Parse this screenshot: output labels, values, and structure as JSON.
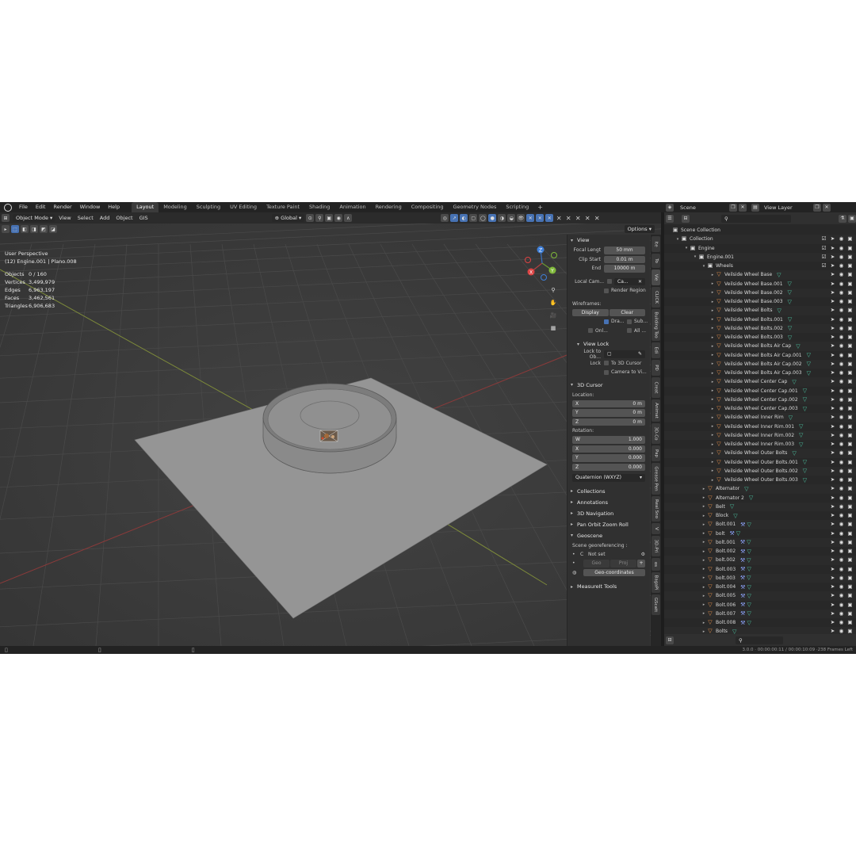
{
  "topbar": {
    "menus": [
      "File",
      "Edit",
      "Render",
      "Window",
      "Help"
    ],
    "workspaces": [
      "Layout",
      "Modeling",
      "Sculpting",
      "UV Editing",
      "Texture Paint",
      "Shading",
      "Animation",
      "Rendering",
      "Compositing",
      "Geometry Nodes",
      "Scripting"
    ],
    "active_workspace": "Layout",
    "add_tab": "+",
    "scene_label": "Scene",
    "view_layer_label": "View Layer"
  },
  "viewport_header": {
    "mode": "Object Mode",
    "menus": [
      "View",
      "Select",
      "Add",
      "Object",
      "GIS"
    ],
    "transform_orientation": "Global",
    "options_label": "Options"
  },
  "viewport": {
    "perspective": "User Perspective",
    "context": "(12) Engine.001 | Plano.008",
    "stats": [
      {
        "label": "Objects",
        "value": "0 / 160"
      },
      {
        "label": "Vertices",
        "value": "3,499,979"
      },
      {
        "label": "Edges",
        "value": "6,963,197"
      },
      {
        "label": "Faces",
        "value": "3,462,561"
      },
      {
        "label": "Triangles",
        "value": "6,906,683"
      }
    ],
    "gizmo_axes": [
      "X",
      "Y",
      "Z"
    ]
  },
  "npanel": {
    "view": {
      "title": "View",
      "focal_length_label": "Focal Lengt",
      "focal_length": "50 mm",
      "clip_start_label": "Clip Start",
      "clip_start": "0.01 m",
      "clip_end_label": "End",
      "clip_end": "10000 m",
      "local_camera_label": "Local Cam...",
      "local_camera_value": "Ca...",
      "render_region_label": "Render Region",
      "wireframes_label": "Wireframes:",
      "display_btn": "Display",
      "clear_btn": "Clear",
      "draw_label": "Dra...",
      "sub_label": "Sub...",
      "onl_label": "Onl...",
      "all_label": "All ..."
    },
    "view_lock": {
      "title": "View Lock",
      "lock_to_object_label": "Lock to Ob...",
      "lock_label": "Lock",
      "to_3d_cursor": "To 3D Cursor",
      "camera_to_view": "Camera to Vi..."
    },
    "cursor": {
      "title": "3D Cursor",
      "location_label": "Location:",
      "location": [
        {
          "axis": "X",
          "value": "0 m"
        },
        {
          "axis": "Y",
          "value": "0 m"
        },
        {
          "axis": "Z",
          "value": "0 m"
        }
      ],
      "rotation_label": "Rotation:",
      "rotation": [
        {
          "axis": "W",
          "value": "1.000"
        },
        {
          "axis": "X",
          "value": "0.000"
        },
        {
          "axis": "Y",
          "value": "0.000"
        },
        {
          "axis": "Z",
          "value": "0.000"
        }
      ],
      "rotation_mode": "Quaternion (WXYZ)"
    },
    "collapsed_sections": [
      "Collections",
      "Annotations",
      "3D Navigation",
      "Pan Orbit Zoom Roll"
    ],
    "geoscene": {
      "title": "Geoscene",
      "georef_label": "Scene georeferencing :",
      "crs_label": "C",
      "crs_value": "Not set",
      "geo_btn": "Geo",
      "proj_btn": "Proj",
      "plus_btn": "+",
      "geo_coords_btn": "Geo-coordinates"
    },
    "measureit": "MeasureIt Tools"
  },
  "vertical_tabs": [
    "Ite",
    "To",
    "Vie",
    "CLICK",
    "Building Too",
    "Edi",
    "PD",
    "Creat",
    "Animat",
    "3D-Co",
    "Pap",
    "Grease Pen",
    "Real Sno",
    "V",
    "3D-Pri",
    "os",
    "BagaPi",
    "GScatt"
  ],
  "outliner": {
    "scene_collection": "Scene Collection",
    "rows": [
      {
        "level": 1,
        "type": "coll",
        "name": "Collection",
        "arrow": "▾",
        "check": true
      },
      {
        "level": 2,
        "type": "coll",
        "name": "Engine",
        "arrow": "▾",
        "check": true
      },
      {
        "level": 3,
        "type": "coll",
        "name": "Engine.001",
        "arrow": "▾",
        "check": true
      },
      {
        "level": 4,
        "type": "coll",
        "name": "Wheels",
        "arrow": "▾",
        "check": true
      },
      {
        "level": 5,
        "type": "obj",
        "name": "Veilside Wheel Base",
        "mod": true
      },
      {
        "level": 5,
        "type": "obj",
        "name": "Veilside Wheel Base.001",
        "mod": true
      },
      {
        "level": 5,
        "type": "obj",
        "name": "Veilside Wheel Base.002",
        "mod": true
      },
      {
        "level": 5,
        "type": "obj",
        "name": "Veilside Wheel Base.003",
        "mod": true
      },
      {
        "level": 5,
        "type": "obj",
        "name": "Veilside Wheel Bolts",
        "mod": true
      },
      {
        "level": 5,
        "type": "obj",
        "name": "Veilside Wheel Bolts.001",
        "mod": true
      },
      {
        "level": 5,
        "type": "obj",
        "name": "Veilside Wheel Bolts.002",
        "mod": true
      },
      {
        "level": 5,
        "type": "obj",
        "name": "Veilside Wheel Bolts.003",
        "mod": true
      },
      {
        "level": 5,
        "type": "obj",
        "name": "Veilside Wheel Bolts Air Cap",
        "mod": true
      },
      {
        "level": 5,
        "type": "obj",
        "name": "Veilside Wheel Bolts Air Cap.001",
        "mod": true
      },
      {
        "level": 5,
        "type": "obj",
        "name": "Veilside Wheel Bolts Air Cap.002",
        "mod": true
      },
      {
        "level": 5,
        "type": "obj",
        "name": "Veilside Wheel Bolts Air Cap.003",
        "mod": true
      },
      {
        "level": 5,
        "type": "obj",
        "name": "Veilside Wheel Center Cap",
        "mod": true
      },
      {
        "level": 5,
        "type": "obj",
        "name": "Veilside Wheel Center Cap.001",
        "mod": true
      },
      {
        "level": 5,
        "type": "obj",
        "name": "Veilside Wheel Center Cap.002",
        "mod": true
      },
      {
        "level": 5,
        "type": "obj",
        "name": "Veilside Wheel Center Cap.003",
        "mod": true
      },
      {
        "level": 5,
        "type": "obj",
        "name": "Veilside Wheel Inner Rim",
        "mod": true
      },
      {
        "level": 5,
        "type": "obj",
        "name": "Veilside Wheel Inner Rim.001",
        "mod": true
      },
      {
        "level": 5,
        "type": "obj",
        "name": "Veilside Wheel Inner Rim.002",
        "mod": true
      },
      {
        "level": 5,
        "type": "obj",
        "name": "Veilside Wheel Inner Rim.003",
        "mod": true
      },
      {
        "level": 5,
        "type": "obj",
        "name": "Veilside Wheel Outer Bolts",
        "mod": true
      },
      {
        "level": 5,
        "type": "obj",
        "name": "Veilside Wheel Outer Bolts.001",
        "mod": true
      },
      {
        "level": 5,
        "type": "obj",
        "name": "Veilside Wheel Outer Bolts.002",
        "mod": true
      },
      {
        "level": 5,
        "type": "obj",
        "name": "Veilside Wheel Outer Bolts.003",
        "mod": true
      },
      {
        "level": 4,
        "type": "obj",
        "name": "Alternator",
        "mod": true
      },
      {
        "level": 4,
        "type": "obj",
        "name": "Alternator 2",
        "mod": true
      },
      {
        "level": 4,
        "type": "obj",
        "name": "Belt",
        "mod": true
      },
      {
        "level": 4,
        "type": "obj",
        "name": "Block",
        "mod": true
      },
      {
        "level": 4,
        "type": "obj",
        "name": "Bolt.001",
        "wrench": true,
        "mod": true
      },
      {
        "level": 4,
        "type": "obj",
        "name": "bolt",
        "wrench": true,
        "mod": true
      },
      {
        "level": 4,
        "type": "obj",
        "name": "bolt.001",
        "wrench": true,
        "mod": true
      },
      {
        "level": 4,
        "type": "obj",
        "name": "Bolt.002",
        "wrench": true,
        "mod": true
      },
      {
        "level": 4,
        "type": "obj",
        "name": "bolt.002",
        "wrench": true,
        "mod": true
      },
      {
        "level": 4,
        "type": "obj",
        "name": "Bolt.003",
        "wrench": true,
        "mod": true
      },
      {
        "level": 4,
        "type": "obj",
        "name": "bolt.003",
        "wrench": true,
        "mod": true
      },
      {
        "level": 4,
        "type": "obj",
        "name": "Bolt.004",
        "wrench": true,
        "mod": true
      },
      {
        "level": 4,
        "type": "obj",
        "name": "Bolt.005",
        "wrench": true,
        "mod": true
      },
      {
        "level": 4,
        "type": "obj",
        "name": "Bolt.006",
        "wrench": true,
        "mod": true
      },
      {
        "level": 4,
        "type": "obj",
        "name": "Bolt.007",
        "wrench": true,
        "mod": true
      },
      {
        "level": 4,
        "type": "obj",
        "name": "Bolt.008",
        "wrench": true,
        "mod": true
      },
      {
        "level": 4,
        "type": "obj",
        "name": "Bolts",
        "mod": true
      }
    ]
  },
  "statusbar": {
    "info": "3.0.0 · 00:00:00:11 / 00:00:10:09 ·238 Frames Left"
  },
  "colors": {
    "accent": "#4772b3",
    "object_icon": "#e9914a",
    "modifier_icon": "#4cc6a3",
    "viewport_bg": "#3d3d3d",
    "ground_plane": "#9a9a9a"
  }
}
